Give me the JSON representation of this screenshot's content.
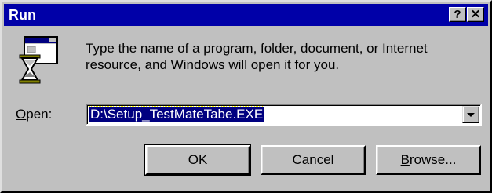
{
  "window": {
    "title": "Run",
    "help_glyph": "?",
    "close_glyph": "✕"
  },
  "dialog": {
    "icon": "run-program-icon",
    "message_line1": "Type the name of a program, folder, document, or Internet",
    "message_line2": "resource, and Windows will open it for you.",
    "open_label_mnemonic": "O",
    "open_label_rest": "pen:",
    "open_value": "D:\\Setup_TestMateTabe.EXE"
  },
  "buttons": {
    "ok": "OK",
    "cancel": "Cancel",
    "browse_mnemonic": "B",
    "browse_rest": "rowse..."
  },
  "colors": {
    "titlebar": "#0000a8",
    "face": "#c0c0c0",
    "selection": "#000080"
  }
}
